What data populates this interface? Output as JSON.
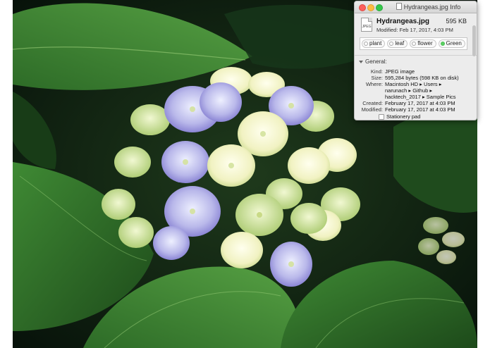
{
  "photo": {
    "alt": "hydrangea-photo"
  },
  "window": {
    "title": "Hydrangeas.jpg Info",
    "file_icon_text": "JPEG",
    "file_name": "Hydrangeas.jpg",
    "file_size": "595 KB",
    "modified": "Modified: Feb 17, 2017, 4:03 PM",
    "tags": [
      {
        "label": "plant",
        "color": "#ffffff"
      },
      {
        "label": "leaf",
        "color": "#ffffff"
      },
      {
        "label": "flower",
        "color": "#ffffff"
      },
      {
        "label": "Green",
        "color": "#5bd063"
      }
    ],
    "section_general": "General:",
    "general": {
      "kind_label": "Kind:",
      "kind": "JPEG image",
      "size_label": "Size:",
      "size": "595,284 bytes (598 KB on disk)",
      "where_label": "Where:",
      "where_1": "Macintosh HD ▸ Users ▸",
      "where_2": "narunach ▸ Github ▸",
      "where_3": "hacktech_2017 ▸ Sample Pics",
      "created_label": "Created:",
      "created": "February 17, 2017 at 4:03 PM",
      "modified_label": "Modified:",
      "modified": "February 17, 2017 at 4:03 PM",
      "stationery": "Stationery pad"
    }
  }
}
